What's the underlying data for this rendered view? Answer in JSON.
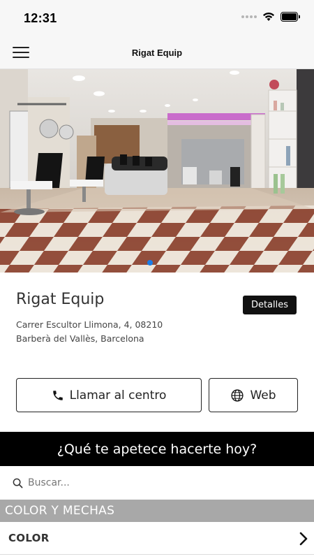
{
  "status_bar": {
    "time": "12:31"
  },
  "nav": {
    "title": "Rigat Equip"
  },
  "salon": {
    "name": "Rigat Equip",
    "details_label": "Detalles",
    "address_line1": "Carrer Escultor Llimona, 4, 08210",
    "address_line2": "Barberà del Vallès, Barcelona"
  },
  "actions": {
    "call_label": "Llamar al centro",
    "web_label": "Web"
  },
  "banner": {
    "text": "¿Qué te apetece hacerte hoy?"
  },
  "search": {
    "placeholder": "Buscar..."
  },
  "section": {
    "header": "COLOR Y MECHAS"
  },
  "categories": [
    {
      "label": "COLOR"
    }
  ],
  "colors": {
    "accent_dot": "#1a7de8",
    "banner_bg": "#000000",
    "section_bg": "#a8a8a8"
  }
}
